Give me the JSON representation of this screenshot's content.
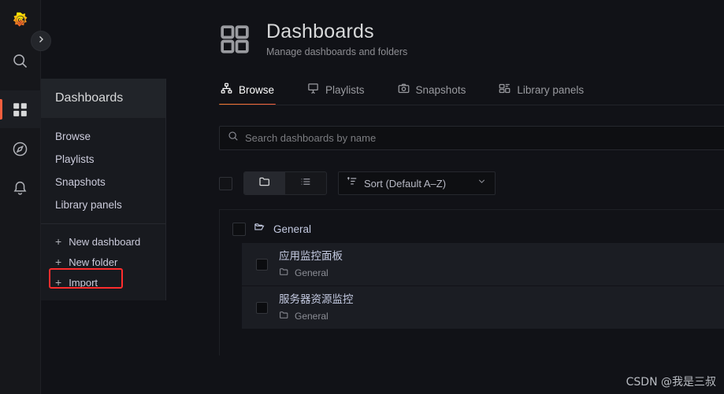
{
  "rail": {
    "logo": "grafana-logo",
    "items": [
      {
        "name": "search",
        "icon": "search-icon",
        "active": false
      },
      {
        "name": "dashboards",
        "icon": "dashboards-grid-icon",
        "active": true
      },
      {
        "name": "explore",
        "icon": "compass-icon",
        "active": false
      },
      {
        "name": "alerting",
        "icon": "bell-icon",
        "active": false
      }
    ],
    "expand_button_icon": "chevron-right-icon"
  },
  "flyout": {
    "header": "Dashboards",
    "links": [
      {
        "label": "Browse"
      },
      {
        "label": "Playlists"
      },
      {
        "label": "Snapshots"
      },
      {
        "label": "Library panels"
      }
    ],
    "actions": [
      {
        "label": "New dashboard",
        "icon": "plus-icon"
      },
      {
        "label": "New folder",
        "icon": "plus-icon"
      },
      {
        "label": "Import",
        "icon": "plus-icon",
        "highlighted": true
      }
    ],
    "highlight_color": "#ff2d2d"
  },
  "header": {
    "icon": "dashboards-grid-icon",
    "title": "Dashboards",
    "subtitle": "Manage dashboards and folders"
  },
  "tabs": [
    {
      "label": "Browse",
      "icon": "sitemap-icon",
      "active": true
    },
    {
      "label": "Playlists",
      "icon": "presentation-icon",
      "active": false
    },
    {
      "label": "Snapshots",
      "icon": "camera-icon",
      "active": false
    },
    {
      "label": "Library panels",
      "icon": "library-panels-icon",
      "active": false
    }
  ],
  "search": {
    "placeholder": "Search dashboards by name",
    "value": "",
    "icon": "search-icon"
  },
  "toolbar": {
    "select_all_checkbox": "unchecked",
    "view_toggle": [
      {
        "name": "folder-view",
        "icon": "folder-icon",
        "active": true
      },
      {
        "name": "list-view",
        "icon": "list-icon",
        "active": false
      }
    ],
    "sort": {
      "label": "Sort (Default A–Z)",
      "icon": "sort-amount-up-icon",
      "chevron": "chevron-down-icon"
    }
  },
  "list": {
    "folder": {
      "name": "General",
      "icon": "folder-open-icon",
      "checkbox": "unchecked"
    },
    "dashboards": [
      {
        "title": "应用监控面板",
        "folder": "General",
        "folder_icon": "folder-icon",
        "checkbox": "unchecked"
      },
      {
        "title": "服务器资源监控",
        "folder": "General",
        "folder_icon": "folder-icon",
        "checkbox": "unchecked"
      }
    ]
  },
  "watermark": {
    "text": "CSDN @我是三叔"
  },
  "accent_color": "#f55f3e"
}
